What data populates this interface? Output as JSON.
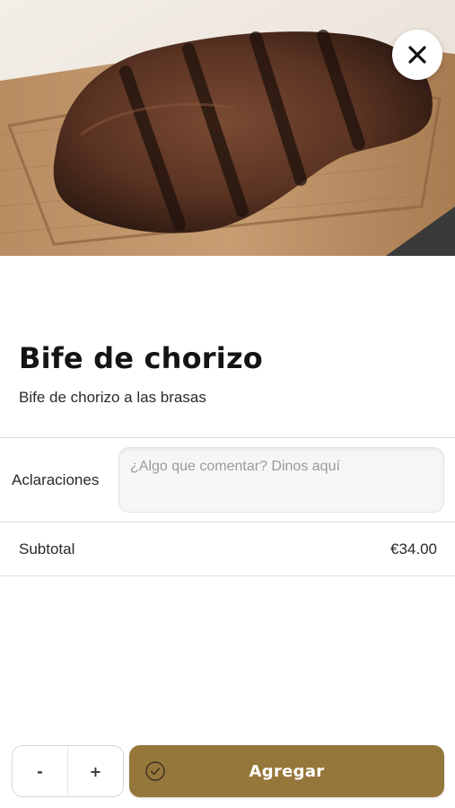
{
  "product": {
    "image_alt": "Bife de chorizo",
    "name": "Bife de chorizo",
    "description": "Bife de chorizo a las brasas"
  },
  "close": {
    "icon": "close-icon"
  },
  "notes": {
    "label": "Aclaraciones",
    "placeholder": "¿Algo que comentar? Dinos aquí",
    "value": ""
  },
  "subtotal": {
    "label": "Subtotal",
    "value": "€34.00"
  },
  "quantity": {
    "decrement_label": "-",
    "increment_label": "+"
  },
  "add_button": {
    "label": "Agregar",
    "icon": "check-circle-icon"
  },
  "colors": {
    "accent": "#96773b"
  }
}
